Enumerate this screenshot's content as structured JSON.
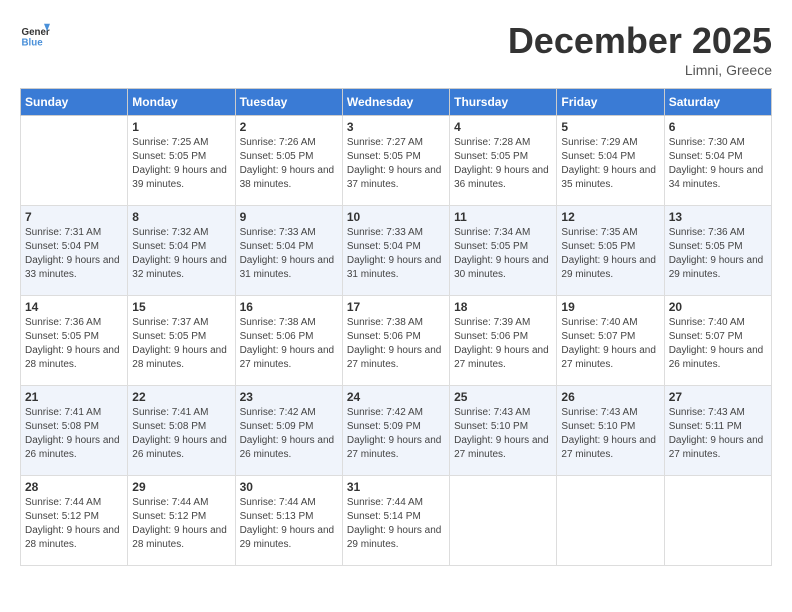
{
  "logo": {
    "general": "General",
    "blue": "Blue"
  },
  "title": "December 2025",
  "location": "Limni, Greece",
  "days_header": [
    "Sunday",
    "Monday",
    "Tuesday",
    "Wednesday",
    "Thursday",
    "Friday",
    "Saturday"
  ],
  "weeks": [
    [
      {
        "day": "",
        "sunrise": "",
        "sunset": "",
        "daylight": ""
      },
      {
        "day": "1",
        "sunrise": "7:25 AM",
        "sunset": "5:05 PM",
        "daylight": "9 hours and 39 minutes."
      },
      {
        "day": "2",
        "sunrise": "7:26 AM",
        "sunset": "5:05 PM",
        "daylight": "9 hours and 38 minutes."
      },
      {
        "day": "3",
        "sunrise": "7:27 AM",
        "sunset": "5:05 PM",
        "daylight": "9 hours and 37 minutes."
      },
      {
        "day": "4",
        "sunrise": "7:28 AM",
        "sunset": "5:05 PM",
        "daylight": "9 hours and 36 minutes."
      },
      {
        "day": "5",
        "sunrise": "7:29 AM",
        "sunset": "5:04 PM",
        "daylight": "9 hours and 35 minutes."
      },
      {
        "day": "6",
        "sunrise": "7:30 AM",
        "sunset": "5:04 PM",
        "daylight": "9 hours and 34 minutes."
      }
    ],
    [
      {
        "day": "7",
        "sunrise": "7:31 AM",
        "sunset": "5:04 PM",
        "daylight": "9 hours and 33 minutes."
      },
      {
        "day": "8",
        "sunrise": "7:32 AM",
        "sunset": "5:04 PM",
        "daylight": "9 hours and 32 minutes."
      },
      {
        "day": "9",
        "sunrise": "7:33 AM",
        "sunset": "5:04 PM",
        "daylight": "9 hours and 31 minutes."
      },
      {
        "day": "10",
        "sunrise": "7:33 AM",
        "sunset": "5:04 PM",
        "daylight": "9 hours and 31 minutes."
      },
      {
        "day": "11",
        "sunrise": "7:34 AM",
        "sunset": "5:05 PM",
        "daylight": "9 hours and 30 minutes."
      },
      {
        "day": "12",
        "sunrise": "7:35 AM",
        "sunset": "5:05 PM",
        "daylight": "9 hours and 29 minutes."
      },
      {
        "day": "13",
        "sunrise": "7:36 AM",
        "sunset": "5:05 PM",
        "daylight": "9 hours and 29 minutes."
      }
    ],
    [
      {
        "day": "14",
        "sunrise": "7:36 AM",
        "sunset": "5:05 PM",
        "daylight": "9 hours and 28 minutes."
      },
      {
        "day": "15",
        "sunrise": "7:37 AM",
        "sunset": "5:05 PM",
        "daylight": "9 hours and 28 minutes."
      },
      {
        "day": "16",
        "sunrise": "7:38 AM",
        "sunset": "5:06 PM",
        "daylight": "9 hours and 27 minutes."
      },
      {
        "day": "17",
        "sunrise": "7:38 AM",
        "sunset": "5:06 PM",
        "daylight": "9 hours and 27 minutes."
      },
      {
        "day": "18",
        "sunrise": "7:39 AM",
        "sunset": "5:06 PM",
        "daylight": "9 hours and 27 minutes."
      },
      {
        "day": "19",
        "sunrise": "7:40 AM",
        "sunset": "5:07 PM",
        "daylight": "9 hours and 27 minutes."
      },
      {
        "day": "20",
        "sunrise": "7:40 AM",
        "sunset": "5:07 PM",
        "daylight": "9 hours and 26 minutes."
      }
    ],
    [
      {
        "day": "21",
        "sunrise": "7:41 AM",
        "sunset": "5:08 PM",
        "daylight": "9 hours and 26 minutes."
      },
      {
        "day": "22",
        "sunrise": "7:41 AM",
        "sunset": "5:08 PM",
        "daylight": "9 hours and 26 minutes."
      },
      {
        "day": "23",
        "sunrise": "7:42 AM",
        "sunset": "5:09 PM",
        "daylight": "9 hours and 26 minutes."
      },
      {
        "day": "24",
        "sunrise": "7:42 AM",
        "sunset": "5:09 PM",
        "daylight": "9 hours and 27 minutes."
      },
      {
        "day": "25",
        "sunrise": "7:43 AM",
        "sunset": "5:10 PM",
        "daylight": "9 hours and 27 minutes."
      },
      {
        "day": "26",
        "sunrise": "7:43 AM",
        "sunset": "5:10 PM",
        "daylight": "9 hours and 27 minutes."
      },
      {
        "day": "27",
        "sunrise": "7:43 AM",
        "sunset": "5:11 PM",
        "daylight": "9 hours and 27 minutes."
      }
    ],
    [
      {
        "day": "28",
        "sunrise": "7:44 AM",
        "sunset": "5:12 PM",
        "daylight": "9 hours and 28 minutes."
      },
      {
        "day": "29",
        "sunrise": "7:44 AM",
        "sunset": "5:12 PM",
        "daylight": "9 hours and 28 minutes."
      },
      {
        "day": "30",
        "sunrise": "7:44 AM",
        "sunset": "5:13 PM",
        "daylight": "9 hours and 29 minutes."
      },
      {
        "day": "31",
        "sunrise": "7:44 AM",
        "sunset": "5:14 PM",
        "daylight": "9 hours and 29 minutes."
      },
      {
        "day": "",
        "sunrise": "",
        "sunset": "",
        "daylight": ""
      },
      {
        "day": "",
        "sunrise": "",
        "sunset": "",
        "daylight": ""
      },
      {
        "day": "",
        "sunrise": "",
        "sunset": "",
        "daylight": ""
      }
    ]
  ]
}
